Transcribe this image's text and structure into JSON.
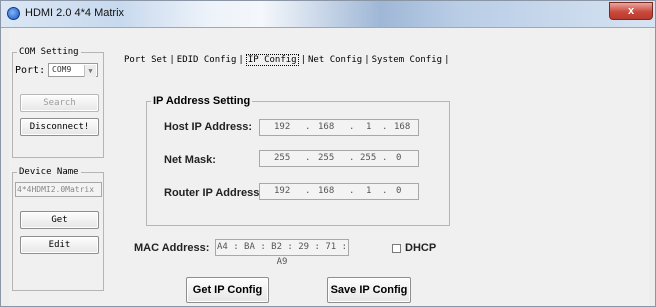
{
  "window": {
    "title": "HDMI 2.0 4*4 Matrix",
    "close_glyph": "x"
  },
  "com_setting": {
    "legend": "COM Setting",
    "port_label": "Port:",
    "port_value": "COM9",
    "search_label": "Search",
    "disconnect_label": "Disconnect!"
  },
  "device_name": {
    "legend": "Device Name",
    "value": "4*4HDMI2.0Matrix",
    "get_label": "Get",
    "edit_label": "Edit"
  },
  "tabs": [
    {
      "label": "Port Set"
    },
    {
      "label": "EDID Config"
    },
    {
      "label": "IP Config"
    },
    {
      "label": "Net Config"
    },
    {
      "label": "System Config"
    }
  ],
  "ip_setting": {
    "legend": "IP Address Setting",
    "host": {
      "label": "Host IP Address:",
      "octets": [
        "192",
        "168",
        "1",
        "168"
      ]
    },
    "mask": {
      "label": "Net Mask:",
      "octets": [
        "255",
        "255",
        "255",
        "0"
      ]
    },
    "router": {
      "label": "Router IP Address:",
      "octets": [
        "192",
        "168",
        "1",
        "0"
      ]
    }
  },
  "mac": {
    "label": "MAC Address:",
    "value": "A4 : BA : B2 : 29 : 71 : A9"
  },
  "dhcp": {
    "label": "DHCP",
    "checked": false
  },
  "buttons": {
    "get_ip": "Get IP Config",
    "save_ip": "Save IP Config"
  }
}
